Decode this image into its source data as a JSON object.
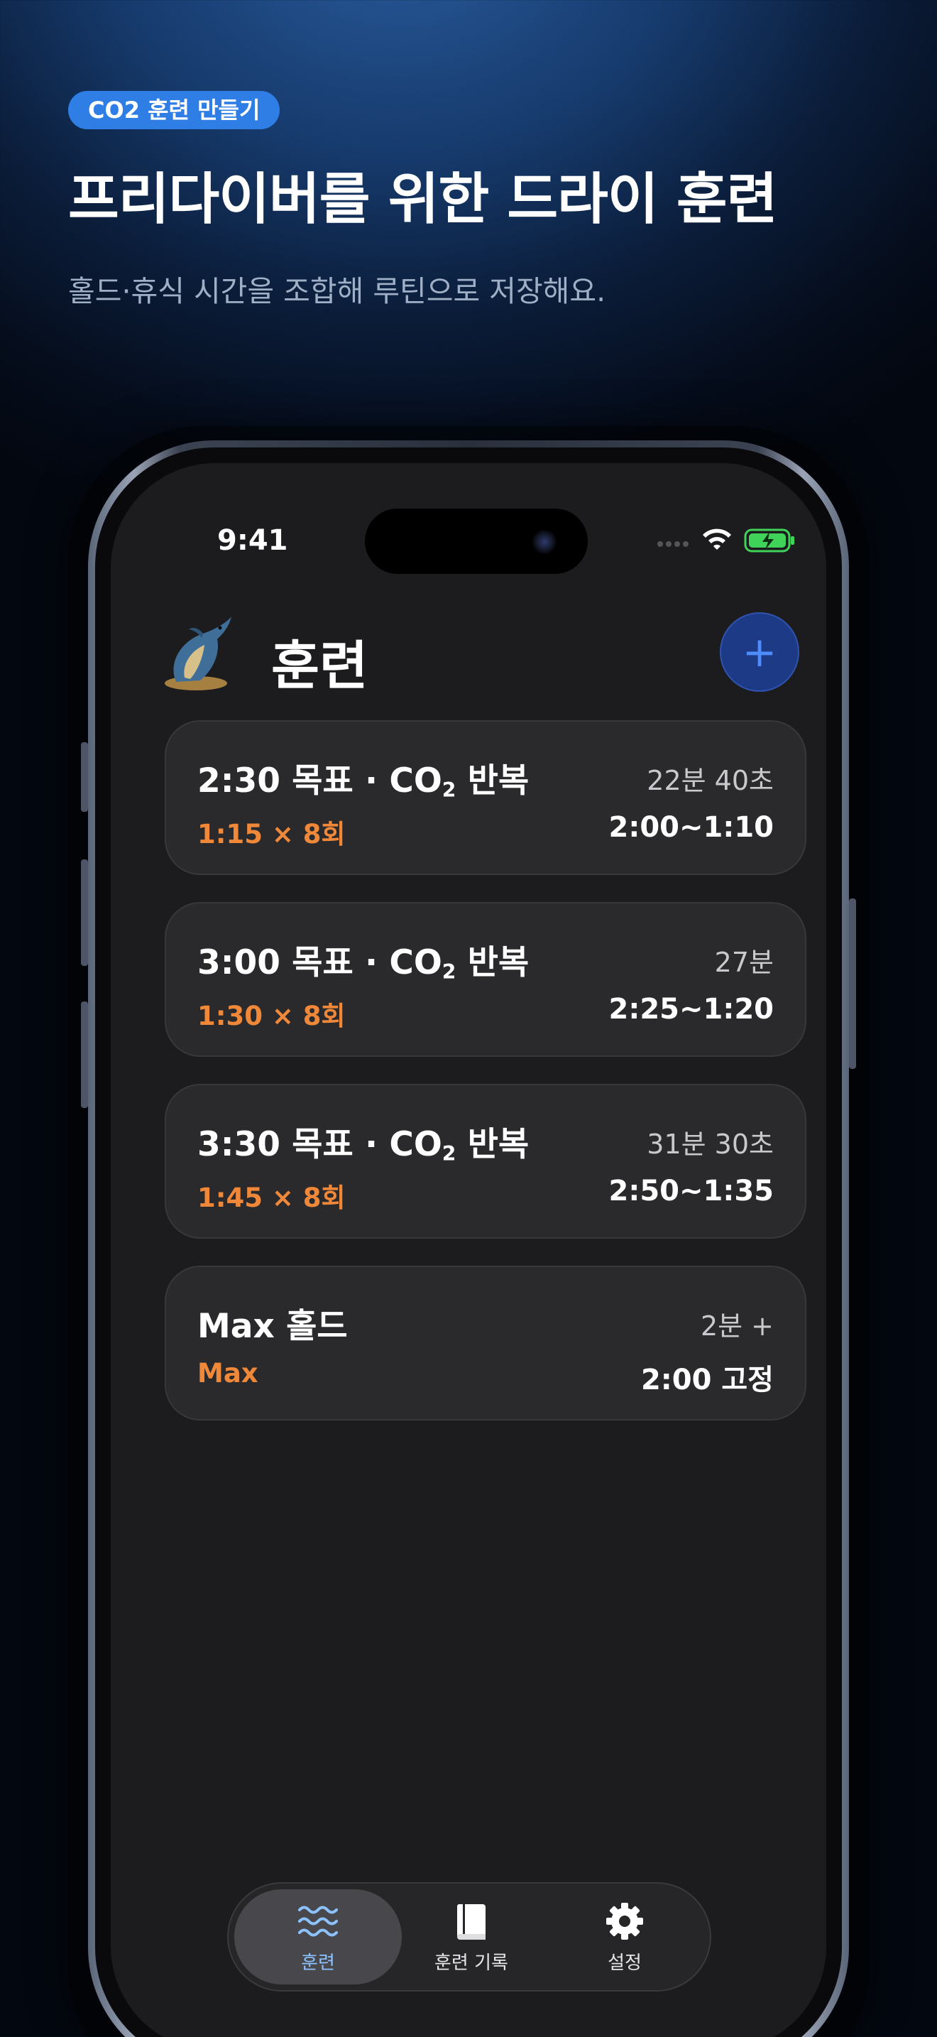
{
  "promo": {
    "badge": "CO2 훈련 만들기",
    "title": "프리다이버를 위한 드라이 훈련",
    "subtitle": "홀드·휴식 시간을 조합해 루틴으로 저장해요."
  },
  "status_bar": {
    "time": "9:41"
  },
  "header": {
    "title": "훈련",
    "add_label": "+"
  },
  "routines": [
    {
      "title_main": "2:30 목표 · CO",
      "title_sub": "2",
      "title_tail": " 반복",
      "duration": "22분 40초",
      "sets": "1:15 × 8회",
      "rest_range": "2:00~1:10"
    },
    {
      "title_main": "3:00 목표 · CO",
      "title_sub": "2",
      "title_tail": " 반복",
      "duration": "27분",
      "sets": "1:30 × 8회",
      "rest_range": "2:25~1:20"
    },
    {
      "title_main": "3:30 목표 · CO",
      "title_sub": "2",
      "title_tail": " 반복",
      "duration": "31분 30초",
      "sets": "1:45 × 8회",
      "rest_range": "2:50~1:35"
    },
    {
      "title_main": "Max 홀드",
      "title_sub": "",
      "title_tail": "",
      "duration": "2분 +",
      "sets": "Max",
      "rest_range": "2:00 고정"
    }
  ],
  "tab_bar": {
    "tabs": [
      {
        "label": "훈련",
        "icon": "waves-icon",
        "active": true
      },
      {
        "label": "훈련 기록",
        "icon": "book-icon",
        "active": false
      },
      {
        "label": "설정",
        "icon": "gear-icon",
        "active": false
      }
    ]
  },
  "colors": {
    "accent_orange": "#f0883a",
    "accent_blue": "#2e7ee6",
    "active_tab": "#8cc2ff"
  }
}
